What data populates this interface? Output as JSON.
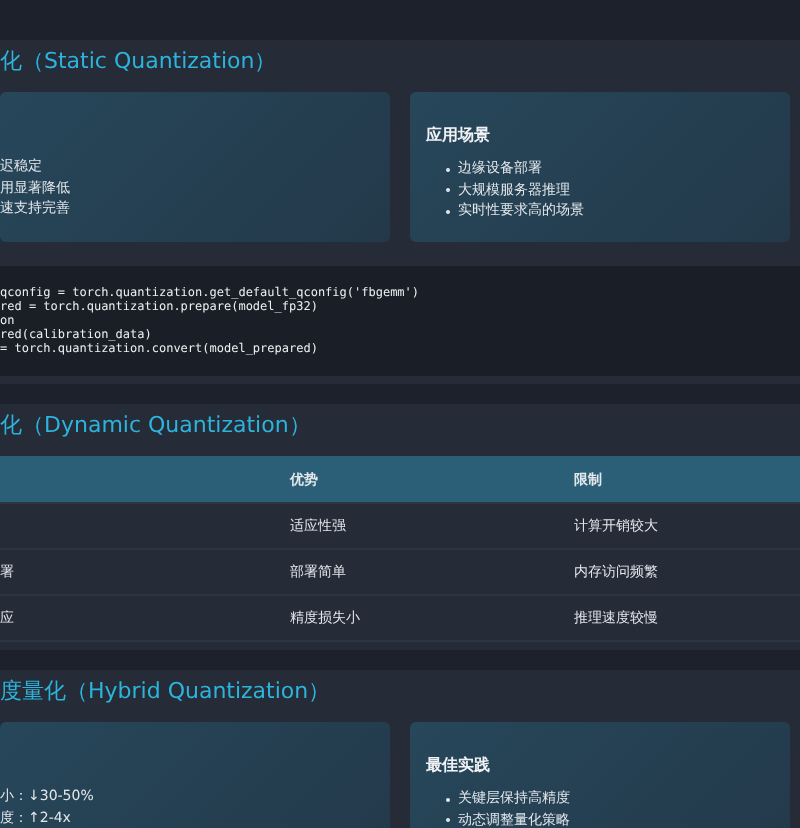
{
  "sections": [
    {
      "title": "化（Static Quantization）",
      "kind": "cards",
      "cards": [
        {
          "items": [
            "迟稳定",
            "用显著降低",
            "速支持完善"
          ]
        },
        {
          "heading": "应用场景",
          "items": [
            "边缘设备部署",
            "大规模服务器推理",
            "实时性要求高的场景"
          ]
        }
      ],
      "code": [
        "qconfig = torch.quantization.get_default_qconfig('fbgemm')",
        "red = torch.quantization.prepare(model_fp32)",
        "on",
        "red(calibration_data)",
        "= torch.quantization.convert(model_prepared)"
      ]
    },
    {
      "title": "化（Dynamic Quantization）",
      "kind": "table",
      "columns": [
        "",
        "优势",
        "限制"
      ],
      "rows": [
        [
          "",
          "适应性强",
          "计算开销较大"
        ],
        [
          "署",
          "部署简单",
          "内存访问频繁"
        ],
        [
          "应",
          "精度损失小",
          "推理速度较慢"
        ]
      ]
    },
    {
      "title": "度量化（Hybrid Quantization）",
      "kind": "cards",
      "cards": [
        {
          "items": [
            "小：↓30-50%",
            "度：↑2-4x"
          ]
        },
        {
          "heading": "最佳实践",
          "items": [
            "关键层保持高精度",
            "动态调整量化策略"
          ]
        }
      ]
    }
  ]
}
